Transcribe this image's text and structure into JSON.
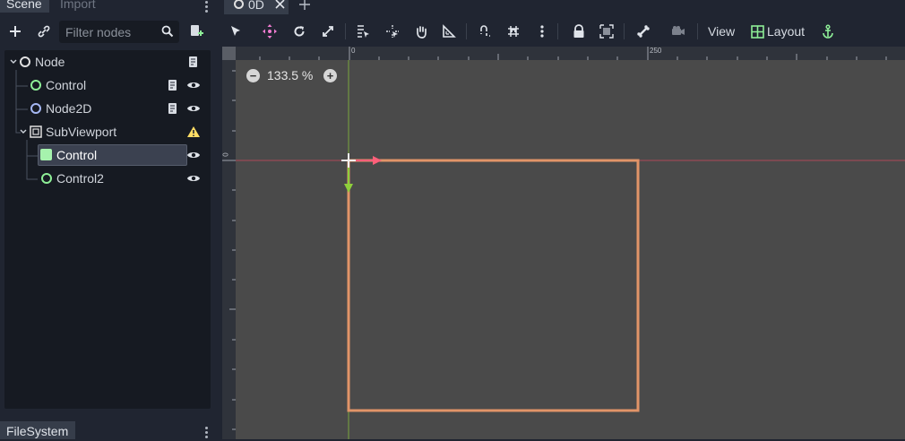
{
  "dock": {
    "tabs": [
      "Scene",
      "Import"
    ],
    "filter_placeholder": "Filter nodes",
    "bottom_tab": "FileSystem"
  },
  "tree": {
    "items": [
      {
        "label": "Node"
      },
      {
        "label": "Control"
      },
      {
        "label": "Node2D"
      },
      {
        "label": "SubViewport"
      },
      {
        "label": "Control"
      },
      {
        "label": "Control2"
      }
    ]
  },
  "editor": {
    "scene_tab": "0D",
    "view_label": "View",
    "layout_label": "Layout"
  },
  "viewport": {
    "zoom": "133.5 %",
    "ruler_top": [
      "0",
      "250"
    ],
    "ruler_left": "0"
  },
  "colors": {
    "accent_green": "#8eef97",
    "selection_rect": "#e19468",
    "axis_x": "#ff5f7a",
    "axis_y": "#8ecf3b",
    "warning": "#ffdd65"
  }
}
